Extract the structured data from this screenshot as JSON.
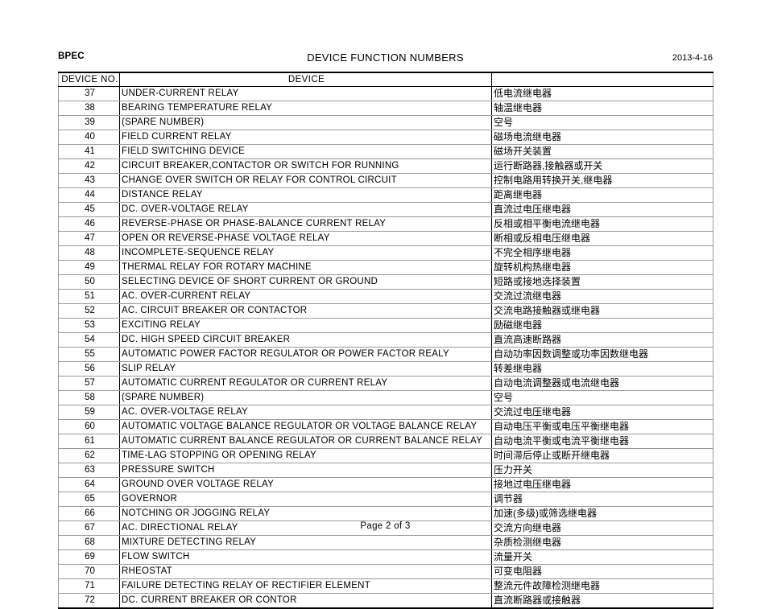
{
  "header": {
    "brand": "BPEC",
    "title": "DEVICE  FUNCTION  NUMBERS",
    "date": "2013-4-16"
  },
  "table": {
    "columns": {
      "device_no": "DEVICE NO.",
      "device": "DEVICE",
      "device_cn": ""
    },
    "rows": [
      {
        "no": "37",
        "desc": "UNDER-CURRENT RELAY",
        "cn": "低电流继电器"
      },
      {
        "no": "38",
        "desc": "BEARING TEMPERATURE RELAY",
        "cn": "轴温继电器"
      },
      {
        "no": "39",
        "desc": "(SPARE NUMBER)",
        "cn": "空号"
      },
      {
        "no": "40",
        "desc": "FIELD CURRENT RELAY",
        "cn": "磁场电流继电器"
      },
      {
        "no": "41",
        "desc": "FIELD SWITCHING DEVICE",
        "cn": "磁场开关装置"
      },
      {
        "no": "42",
        "desc": "CIRCUIT BREAKER,CONTACTOR OR SWITCH FOR RUNNING",
        "cn": "运行断路器,接触器或开关"
      },
      {
        "no": "43",
        "desc": "CHANGE OVER SWITCH OR RELAY FOR CONTROL CIRCUIT",
        "cn": "控制电路用转换开关,继电器"
      },
      {
        "no": "44",
        "desc": "DISTANCE RELAY",
        "cn": "距离继电器"
      },
      {
        "no": "45",
        "desc": "DC. OVER-VOLTAGE RELAY",
        "cn": "直流过电压继电器"
      },
      {
        "no": "46",
        "desc": "REVERSE-PHASE OR PHASE-BALANCE CURRENT RELAY",
        "cn": "反相或相平衡电流继电器"
      },
      {
        "no": "47",
        "desc": "OPEN OR REVERSE-PHASE VOLTAGE RELAY",
        "cn": "断相或反相电压继电器"
      },
      {
        "no": "48",
        "desc": "INCOMPLETE-SEQUENCE RELAY",
        "cn": "不完全相序继电器"
      },
      {
        "no": "49",
        "desc": "THERMAL RELAY FOR ROTARY MACHINE",
        "cn": "旋转机构热继电器"
      },
      {
        "no": "50",
        "desc": "SELECTING DEVICE OF SHORT CURRENT OR GROUND",
        "cn": "短路或接地选择装置"
      },
      {
        "no": "51",
        "desc": "AC. OVER-CURRENT RELAY",
        "cn": "交流过流继电器"
      },
      {
        "no": "52",
        "desc": "AC. CIRCUIT BREAKER OR CONTACTOR",
        "cn": "交流电路接触器或继电器"
      },
      {
        "no": "53",
        "desc": "EXCITING RELAY",
        "cn": "励磁继电器"
      },
      {
        "no": "54",
        "desc": "DC. HIGH SPEED CIRCUIT BREAKER",
        "cn": "直流高速断路器"
      },
      {
        "no": "55",
        "desc": "AUTOMATIC POWER FACTOR REGULATOR OR POWER FACTOR REALY",
        "cn": "自动功率因数调整或功率因数继电器"
      },
      {
        "no": "56",
        "desc": "SLIP RELAY",
        "cn": "转差继电器"
      },
      {
        "no": "57",
        "desc": "AUTOMATIC CURRENT REGULATOR OR CURRENT RELAY",
        "cn": "自动电流调整器或电流继电器"
      },
      {
        "no": "58",
        "desc": "(SPARE NUMBER)",
        "cn": "空号"
      },
      {
        "no": "59",
        "desc": "AC. OVER-VOLTAGE RELAY",
        "cn": "交流过电压继电器"
      },
      {
        "no": "60",
        "desc": "AUTOMATIC VOLTAGE BALANCE REGULATOR OR VOLTAGE BALANCE RELAY",
        "cn": "自动电压平衡或电压平衡继电器"
      },
      {
        "no": "61",
        "desc": "AUTOMATIC CURRENT BALANCE REGULATOR OR CURRENT BALANCE RELAY",
        "cn": "自动电流平衡或电流平衡继电器"
      },
      {
        "no": "62",
        "desc": "TIME-LAG STOPPING OR OPENING RELAY",
        "cn": "时间滞后停止或断开继电器"
      },
      {
        "no": "63",
        "desc": "PRESSURE SWITCH",
        "cn": "压力开关"
      },
      {
        "no": "64",
        "desc": "GROUND OVER VOLTAGE RELAY",
        "cn": "接地过电压继电器"
      },
      {
        "no": "65",
        "desc": "GOVERNOR",
        "cn": "调节器"
      },
      {
        "no": "66",
        "desc": "NOTCHING OR JOGGING RELAY",
        "cn": "加速(多级)或筛选继电器"
      },
      {
        "no": "67",
        "desc": "AC. DIRECTIONAL RELAY",
        "cn": "交流方向继电器"
      },
      {
        "no": "68",
        "desc": "MIXTURE DETECTING RELAY",
        "cn": "杂质检测继电器"
      },
      {
        "no": "69",
        "desc": "FLOW SWITCH",
        "cn": "流量开关"
      },
      {
        "no": "70",
        "desc": "RHEOSTAT",
        "cn": "可变电阻器"
      },
      {
        "no": "71",
        "desc": "FAILURE DETECTING RELAY OF RECTIFIER ELEMENT",
        "cn": "整流元件故障检测继电器"
      },
      {
        "no": "72",
        "desc": "DC. CURRENT BREAKER OR CONTOR",
        "cn": "直流断路器或接触器"
      }
    ]
  },
  "footer": {
    "page_label": "Page 2 of 3"
  }
}
